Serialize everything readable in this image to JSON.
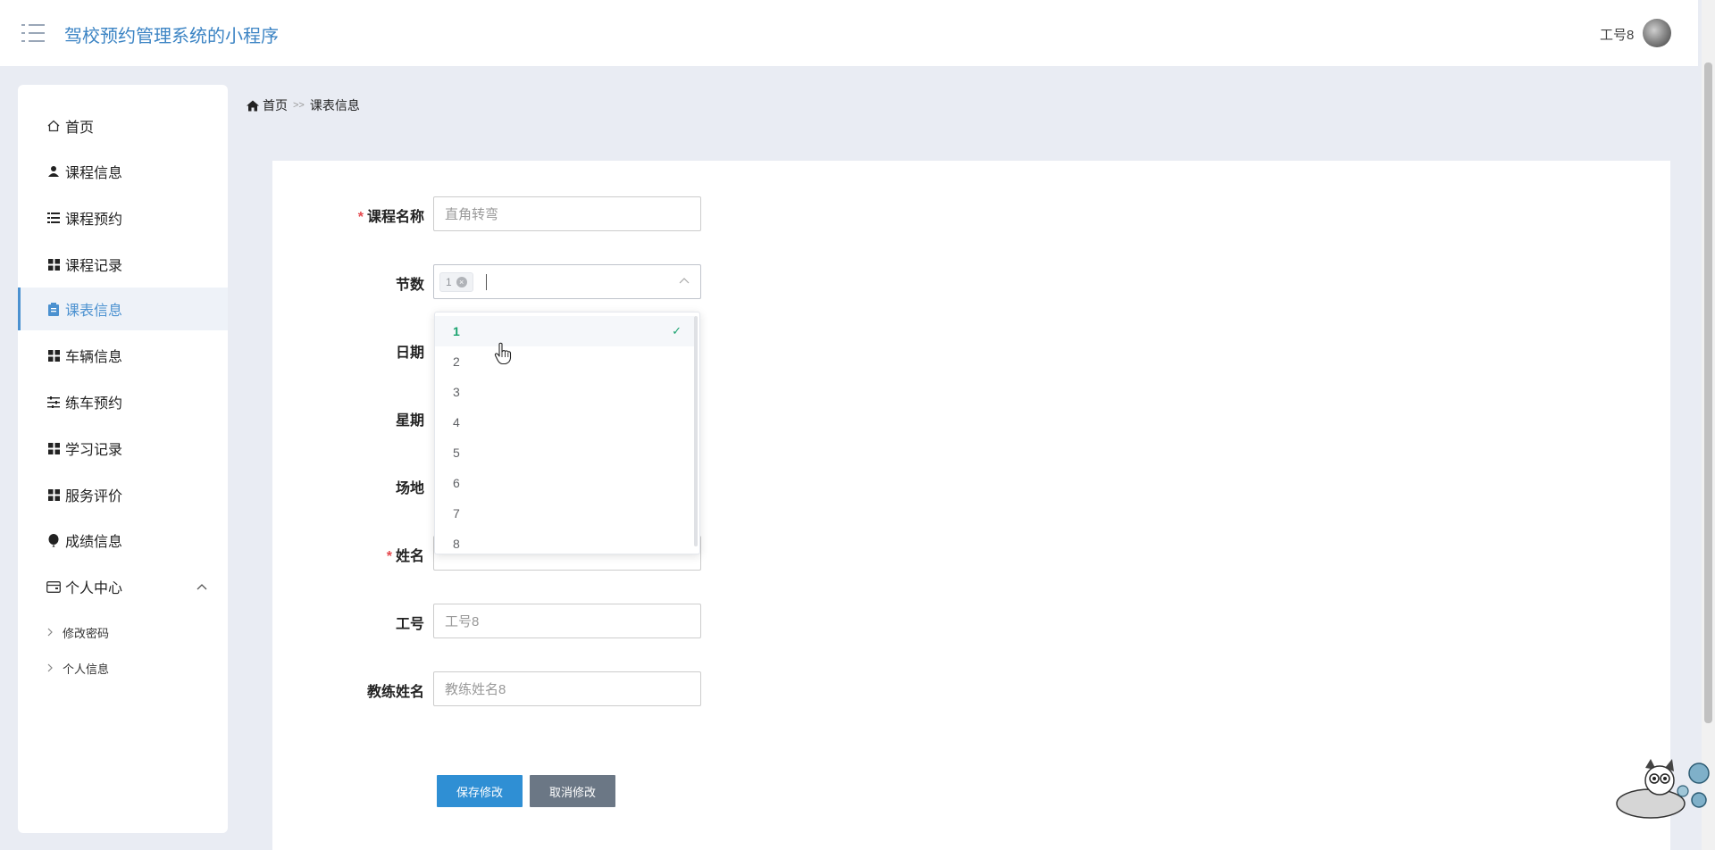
{
  "header": {
    "title": "驾校预约管理系统的小程序",
    "user": "工号8"
  },
  "breadcrumb": {
    "home": "首页",
    "separator": ">>",
    "current": "课表信息"
  },
  "sidebar": {
    "items": [
      {
        "label": "首页",
        "icon": "home-icon"
      },
      {
        "label": "课程信息",
        "icon": "user-icon"
      },
      {
        "label": "课程预约",
        "icon": "list-icon"
      },
      {
        "label": "课程记录",
        "icon": "grid-icon"
      },
      {
        "label": "课表信息",
        "icon": "clipboard-icon",
        "active": true
      },
      {
        "label": "车辆信息",
        "icon": "grid-icon"
      },
      {
        "label": "练车预约",
        "icon": "sliders-icon"
      },
      {
        "label": "学习记录",
        "icon": "grid-icon"
      },
      {
        "label": "服务评价",
        "icon": "grid-icon"
      },
      {
        "label": "成绩信息",
        "icon": "balloon-icon"
      },
      {
        "label": "个人中心",
        "icon": "wallet-icon"
      }
    ],
    "sub_items": [
      "修改密码",
      "个人信息"
    ]
  },
  "form": {
    "course_name": {
      "label": "课程名称",
      "required": true,
      "value": "直角转弯"
    },
    "section": {
      "label": "节数",
      "tag": "1"
    },
    "date": {
      "label": "日期"
    },
    "weekday": {
      "label": "星期"
    },
    "venue": {
      "label": "场地"
    },
    "name": {
      "label": "姓名",
      "required": true
    },
    "work_id": {
      "label": "工号",
      "value": "工号8"
    },
    "coach_name": {
      "label": "教练姓名",
      "value": "教练姓名8"
    }
  },
  "dropdown": {
    "options": [
      "1",
      "2",
      "3",
      "4",
      "5",
      "6",
      "7",
      "8"
    ],
    "selected": "1"
  },
  "buttons": {
    "save": "保存修改",
    "cancel": "取消修改"
  },
  "colors": {
    "accent": "#3c84c4",
    "active_nav": "#4b91d0",
    "save": "#2f8fd4",
    "cancel": "#6b7785",
    "selected_option": "#1aa36f",
    "required": "#e5484d"
  }
}
